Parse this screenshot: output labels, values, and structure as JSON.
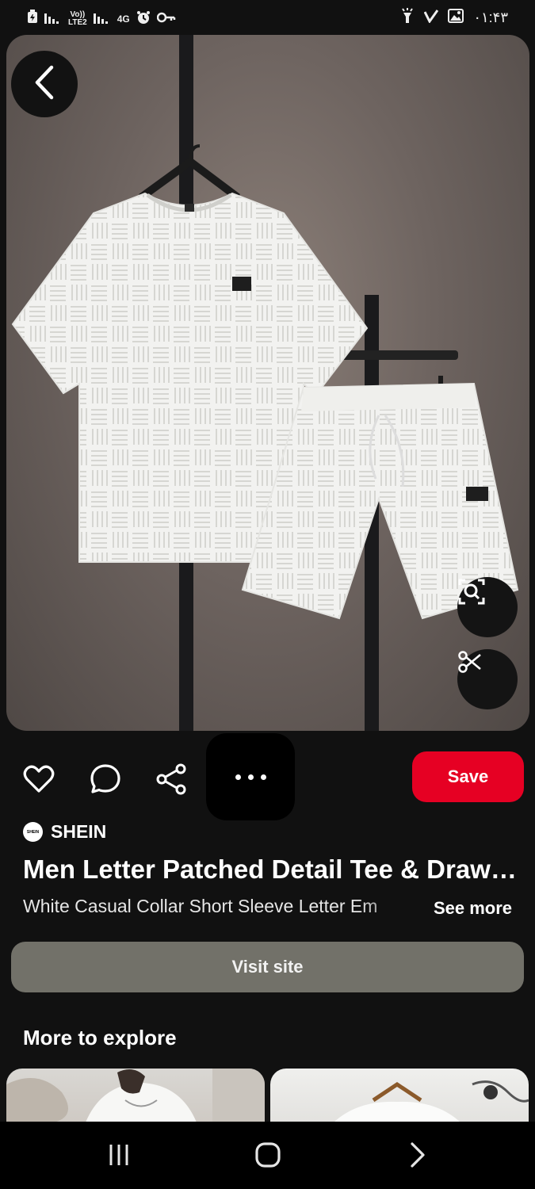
{
  "status_bar": {
    "network_label_top": "Vo))",
    "network_label_bottom": "LTE2",
    "data_type": "4G",
    "time": "۰۱:۴۳",
    "icons": [
      "battery-saver-icon",
      "signal-icon",
      "signal-icon",
      "alarm-icon",
      "key-icon",
      "flashlight-icon",
      "check-icon",
      "image-icon"
    ]
  },
  "hero": {
    "image_description_icon": "product-photo",
    "back_icon": "chevron-left-icon",
    "lens_icon": "visual-search-icon",
    "crop_icon": "scissors-icon"
  },
  "actions": {
    "like_icon": "heart-icon",
    "comment_icon": "comment-icon",
    "share_icon": "share-icon",
    "more_icon": "more-horizontal-icon",
    "save_label": "Save"
  },
  "pin": {
    "source_logo_text": "SHEIN",
    "source_name": "SHEIN",
    "title": "Men Letter Patched Detail Tee & Drawstring Waist Shorts",
    "description": "White Casual Collar Short Sleeve  Letter  Em",
    "see_more": "See more",
    "visit_site": "Visit site"
  },
  "explore": {
    "title": "More to explore"
  },
  "nav": {
    "recents_icon": "recents-icon",
    "home_icon": "home-icon",
    "back_icon": "nav-back-icon"
  },
  "colors": {
    "background": "#111111",
    "save": "#e60023",
    "visit": "#727169"
  }
}
